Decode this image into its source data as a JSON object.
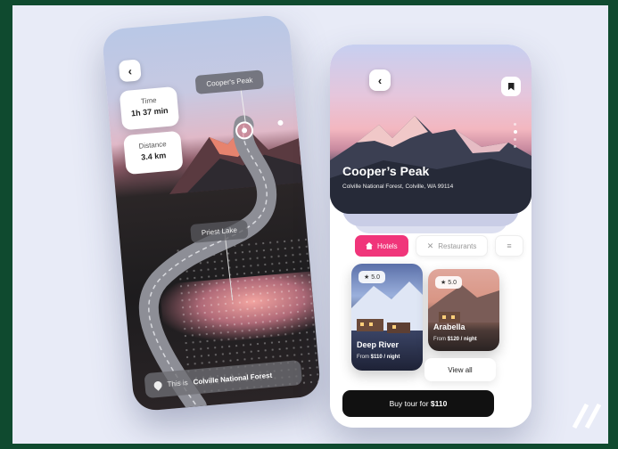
{
  "map_screen": {
    "stats": [
      {
        "label": "Time",
        "value": "1h 37 min"
      },
      {
        "label": "Distance",
        "value": "3.4 km"
      }
    ],
    "peak_label": "Cooper's Peak",
    "lake_label": "Priest Lake",
    "location_prefix": "This is",
    "location_name": "Colville National Forest"
  },
  "detail_screen": {
    "title": "Cooper’s Peak",
    "subtitle": "Colville National Forest, Colville, WA 99114",
    "tabs": [
      {
        "label": "Hotels",
        "icon": "home-icon",
        "active": true
      },
      {
        "label": "Restaurants",
        "icon": "cutlery-icon",
        "active": false
      }
    ],
    "hotels": [
      {
        "name": "Deep River",
        "rating": "5.0",
        "price_prefix": "From",
        "price": "$110 / night"
      },
      {
        "name": "Arabella",
        "rating": "5.0",
        "price_prefix": "From",
        "price": "$120 / night"
      }
    ],
    "view_all_label": "View all",
    "buy_label": "Buy tour for",
    "buy_price": "$110",
    "accent_color": "#f0357a"
  }
}
